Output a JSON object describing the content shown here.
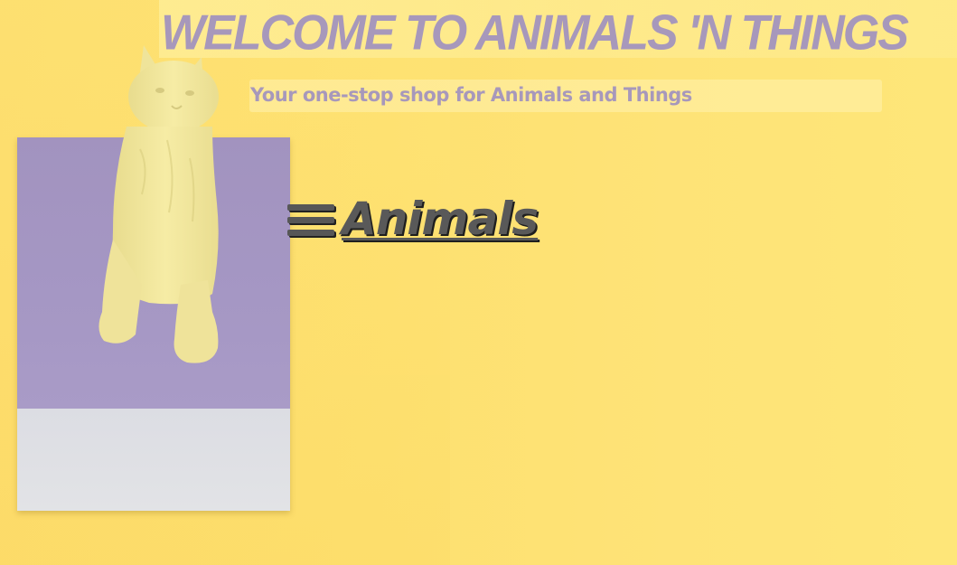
{
  "header": {
    "title": "WELCOME TO ANIMALS 'N THINGS",
    "subtitle": "Your one-stop shop for Animals and Things"
  },
  "nav": {
    "menu_icon": "hamburger-menu-icon",
    "link_label": "Animals"
  },
  "colors": {
    "background": "#fde070",
    "title_text": "#a798bb",
    "nav_text": "#595959",
    "card_purple": "#a597c4",
    "card_white": "#e0e1e5",
    "figurine": "#f4eaa0"
  }
}
